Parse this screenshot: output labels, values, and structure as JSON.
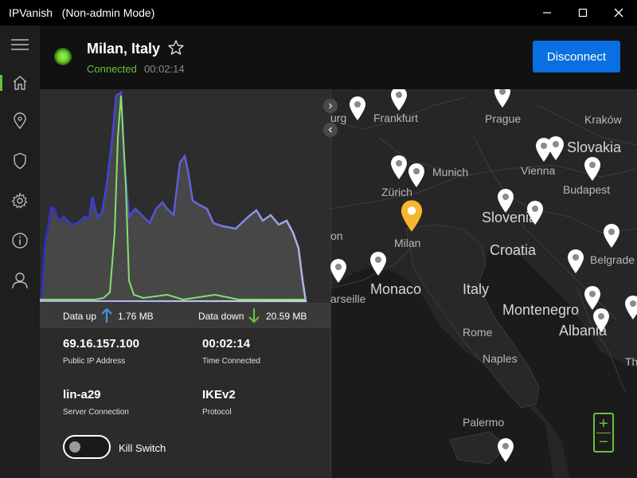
{
  "window": {
    "title": "IPVanish   (Non-admin Mode)",
    "controls": [
      "minimize-icon",
      "maximize-icon",
      "close-icon"
    ]
  },
  "sidebar": {
    "items": [
      {
        "name": "menu",
        "icon": "hamburger-icon"
      },
      {
        "name": "home",
        "icon": "home-icon",
        "active": true
      },
      {
        "name": "location",
        "icon": "location-pin-icon"
      },
      {
        "name": "security",
        "icon": "shield-icon"
      },
      {
        "name": "settings",
        "icon": "gear-icon"
      },
      {
        "name": "info",
        "icon": "info-icon"
      },
      {
        "name": "account",
        "icon": "user-icon"
      }
    ]
  },
  "header": {
    "location": "Milan, Italy",
    "status": "Connected",
    "elapsed": "00:02:14",
    "disconnect_label": "Disconnect"
  },
  "stats": {
    "data_up_label": "Data up",
    "data_up_value": "1.76 MB",
    "data_down_label": "Data down",
    "data_down_value": "20.59 MB",
    "ip_value": "69.16.157.100",
    "ip_label": "Public IP Address",
    "time_value": "00:02:14",
    "time_label": "Time Connected",
    "server_value": "lin-a29",
    "server_label": "Server Connection",
    "protocol_value": "IKEv2",
    "protocol_label": "Protocol",
    "kill_switch_label": "Kill Switch",
    "kill_switch_on": false
  },
  "map": {
    "cities": [
      "Frankfurt",
      "Prague",
      "Kraków",
      "Munich",
      "Vienna",
      "Zürich",
      "Budapest",
      "Milan",
      "Belgrade",
      "Rome",
      "Naples",
      "Palermo"
    ],
    "partial_labels": [
      "urg",
      "on",
      "arseille",
      "Th"
    ],
    "countries": [
      "Slovakia",
      "Slovenia",
      "Croatia",
      "Monaco",
      "Italy",
      "Montenegro",
      "Albania"
    ],
    "zoom_in": "+",
    "zoom_out": "−",
    "colors": {
      "selected_pin": "#f5b731",
      "pin": "#ffffff",
      "accent": "#6bbf3c"
    }
  },
  "colors": {
    "accent_green": "#6bbf3c",
    "button_blue": "#0a6fe0",
    "upload_arrow": "#4a8fe7",
    "download_arrow": "#6bbf3c"
  }
}
